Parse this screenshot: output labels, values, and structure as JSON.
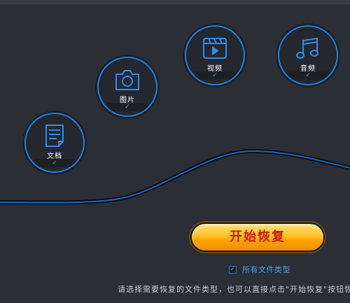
{
  "categories": [
    {
      "label": "文档",
      "icon": "document-icon",
      "checked": true
    },
    {
      "label": "图片",
      "icon": "camera-icon",
      "checked": true
    },
    {
      "label": "视频",
      "icon": "video-icon",
      "checked": true
    },
    {
      "label": "音频",
      "icon": "music-icon",
      "checked": true
    }
  ],
  "check_mark": "✓",
  "start_button": {
    "label": "开始恢复"
  },
  "all_types": {
    "label": "所有文件类型",
    "checked": true
  },
  "hint": "请选择需要恢复的文件类型，也可以直接点击\"开始恢复\"按钮恢复",
  "colors": {
    "background": "#2b2e35",
    "accent": "#1f7fe0",
    "button_top": "#ffe07a",
    "button_bottom": "#f08a00",
    "button_text": "#c81e0c"
  }
}
